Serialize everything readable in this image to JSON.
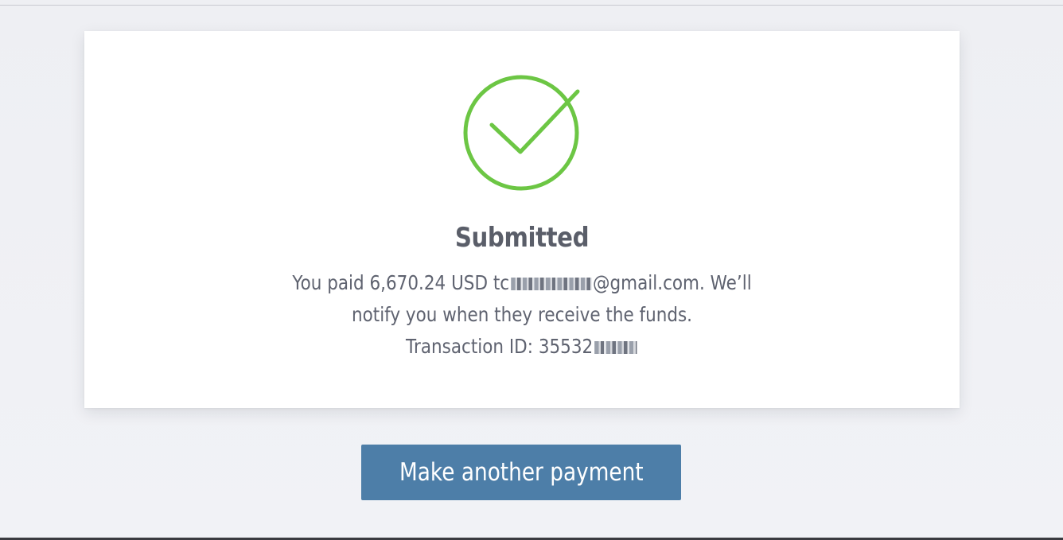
{
  "status": {
    "title": "Submitted",
    "icon": "check-circle-icon",
    "icon_color": "#6cc644"
  },
  "message": {
    "paid_prefix": "You paid 6,670.24 USD tc",
    "email_suffix": "@gmail.com. We’ll",
    "line2": "notify you when they receive the funds.",
    "transaction_prefix": "Transaction ID: 35532"
  },
  "actions": {
    "make_another_label": "Make another payment",
    "button_color": "#4d7ea8"
  }
}
